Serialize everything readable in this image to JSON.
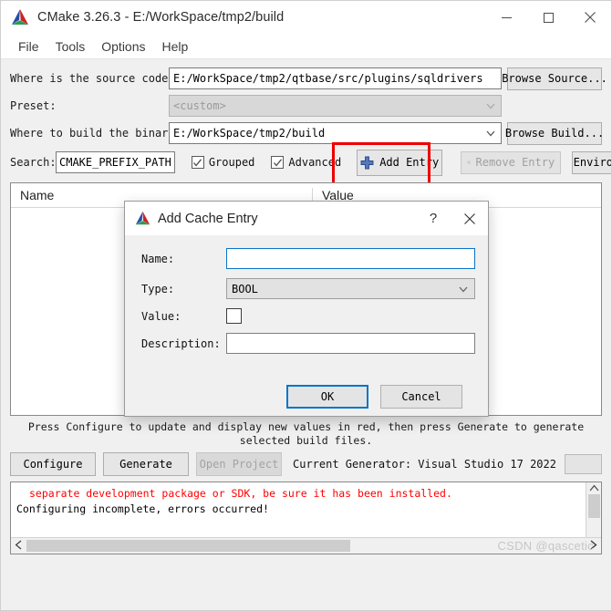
{
  "window": {
    "title": "CMake 3.26.3 - E:/WorkSpace/tmp2/build",
    "logo_icon": "cmake-logo-icon",
    "minimize_icon": "minimize-icon",
    "maximize_icon": "maximize-icon",
    "close_icon": "close-icon"
  },
  "menubar": {
    "items": [
      {
        "label": "File"
      },
      {
        "label": "Tools"
      },
      {
        "label": "Options"
      },
      {
        "label": "Help"
      }
    ]
  },
  "form": {
    "source_label": "Where is the source code:",
    "source_value": "E:/WorkSpace/tmp2/qtbase/src/plugins/sqldrivers",
    "browse_source_label": "Browse Source...",
    "preset_label": "Preset:",
    "preset_value": "<custom>",
    "binaries_label": "Where to build the binaries:",
    "binaries_value": "E:/WorkSpace/tmp2/build",
    "browse_build_label": "Browse Build..."
  },
  "search": {
    "label": "Search:",
    "value": "CMAKE_PREFIX_PATH",
    "grouped_label": "Grouped",
    "grouped_checked": true,
    "advanced_label": "Advanced",
    "advanced_checked": true,
    "add_entry_label": "Add Entry",
    "add_entry_icon": "plus-icon",
    "remove_entry_label": "Remove Entry",
    "remove_entry_icon": "remove-icon",
    "environment_label": "Environment...",
    "highlight_color": "#ee0000"
  },
  "cache_table": {
    "columns": [
      "Name",
      "Value"
    ],
    "rows": []
  },
  "footer": {
    "hint_line1": "Press Configure to update and display new values in red, then press Generate to generate selected build",
    "hint_line2": "files.",
    "configure_label": "Configure",
    "generate_label": "Generate",
    "open_project_label": "Open Project",
    "current_generator_label": "Current Generator: Visual Studio 17 2022"
  },
  "output": {
    "error_line": "separate development package or SDK, be sure it has been installed.",
    "blank_line": "",
    "status_line": "Configuring incomplete, errors occurred!",
    "error_color": "#ff0000",
    "scroll_up_icon": "chevron-up-icon",
    "scroll_down_icon": "chevron-down-icon",
    "scroll_left_icon": "chevron-left-icon",
    "scroll_right_icon": "chevron-right-icon"
  },
  "watermark": {
    "text": "CSDN @qascetic"
  },
  "dialog": {
    "title": "Add Cache Entry",
    "logo_icon": "cmake-logo-icon",
    "help_label": "?",
    "close_icon": "close-icon",
    "name_label": "Name:",
    "name_value": "",
    "name_placeholder": "",
    "type_label": "Type:",
    "type_value": "BOOL",
    "value_label": "Value:",
    "value_checked": false,
    "description_label": "Description:",
    "description_value": "",
    "description_placeholder": "",
    "ok_label": "OK",
    "cancel_label": "Cancel",
    "focus_color": "#0a74c8"
  }
}
